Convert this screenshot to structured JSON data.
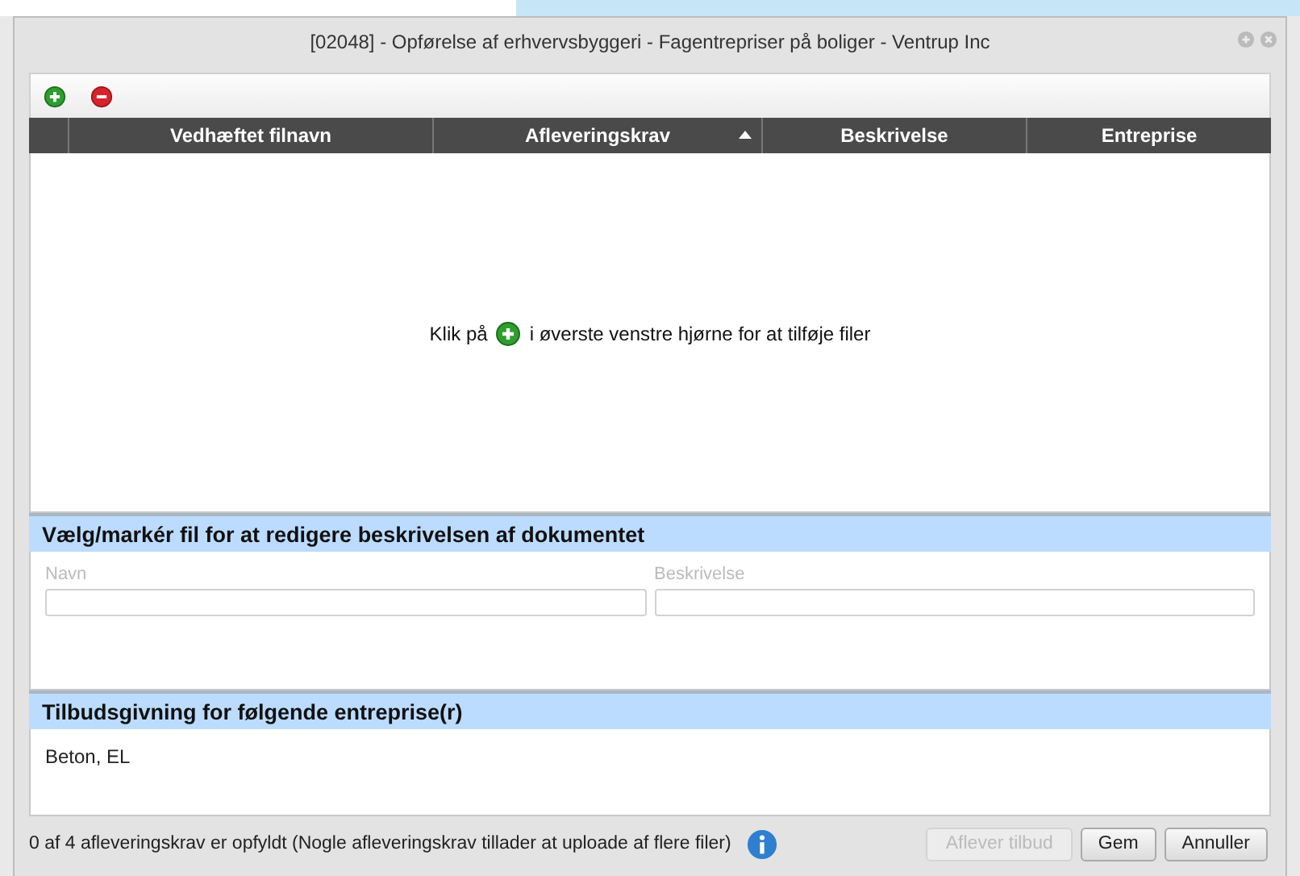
{
  "window": {
    "title": "[02048] - Opførelse af erhvervsbyggeri - Fagentrepriser på boliger - Ventrup Inc"
  },
  "table": {
    "columns": [
      {
        "label": "Vedhæftet filnavn",
        "sorted": false
      },
      {
        "label": "Afleveringskrav",
        "sorted": true
      },
      {
        "label": "Beskrivelse",
        "sorted": false
      },
      {
        "label": "Entreprise",
        "sorted": false
      }
    ],
    "empty_message": {
      "before": "Klik på",
      "after": "i øverste venstre hjørne for at tilføje filer"
    }
  },
  "edit_section": {
    "heading": "Vælg/markér fil for at redigere beskrivelsen af dokumentet",
    "fields": [
      {
        "label": "Navn",
        "disabled": true
      },
      {
        "label": "Beskrivelse",
        "disabled": true
      }
    ]
  },
  "entreprise_section": {
    "heading": "Tilbudsgivning for følgende entreprise(r)",
    "text": "Beton, EL"
  },
  "footer": {
    "status": "0 af 4 afleveringskrav er opfyldt (Nogle afleveringskrav tillader at uploade af flere filer)",
    "buttons": [
      {
        "label": "Aflever tilbud",
        "disabled": true
      },
      {
        "label": "Gem",
        "disabled": false
      },
      {
        "label": "Annuller",
        "disabled": false
      }
    ]
  }
}
